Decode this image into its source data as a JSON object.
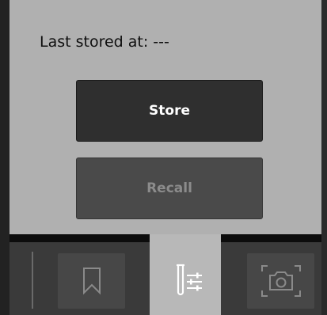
{
  "status": {
    "text": "Last stored at: ---"
  },
  "buttons": {
    "store_label": "Store",
    "recall_label": "Recall"
  },
  "toolbar": {
    "items": [
      {
        "icon": "bookmark-icon",
        "active": false
      },
      {
        "icon": "sample-settings-icon",
        "active": true
      },
      {
        "icon": "camera-icon",
        "active": false
      }
    ]
  },
  "colors": {
    "panel_bg": "#b0b0b0",
    "button_dark": "#2f2f2f",
    "button_disabled": "#4a4a4a",
    "toolbar_bg": "#3a3a3a",
    "active_tab": "#b8b8b8"
  }
}
